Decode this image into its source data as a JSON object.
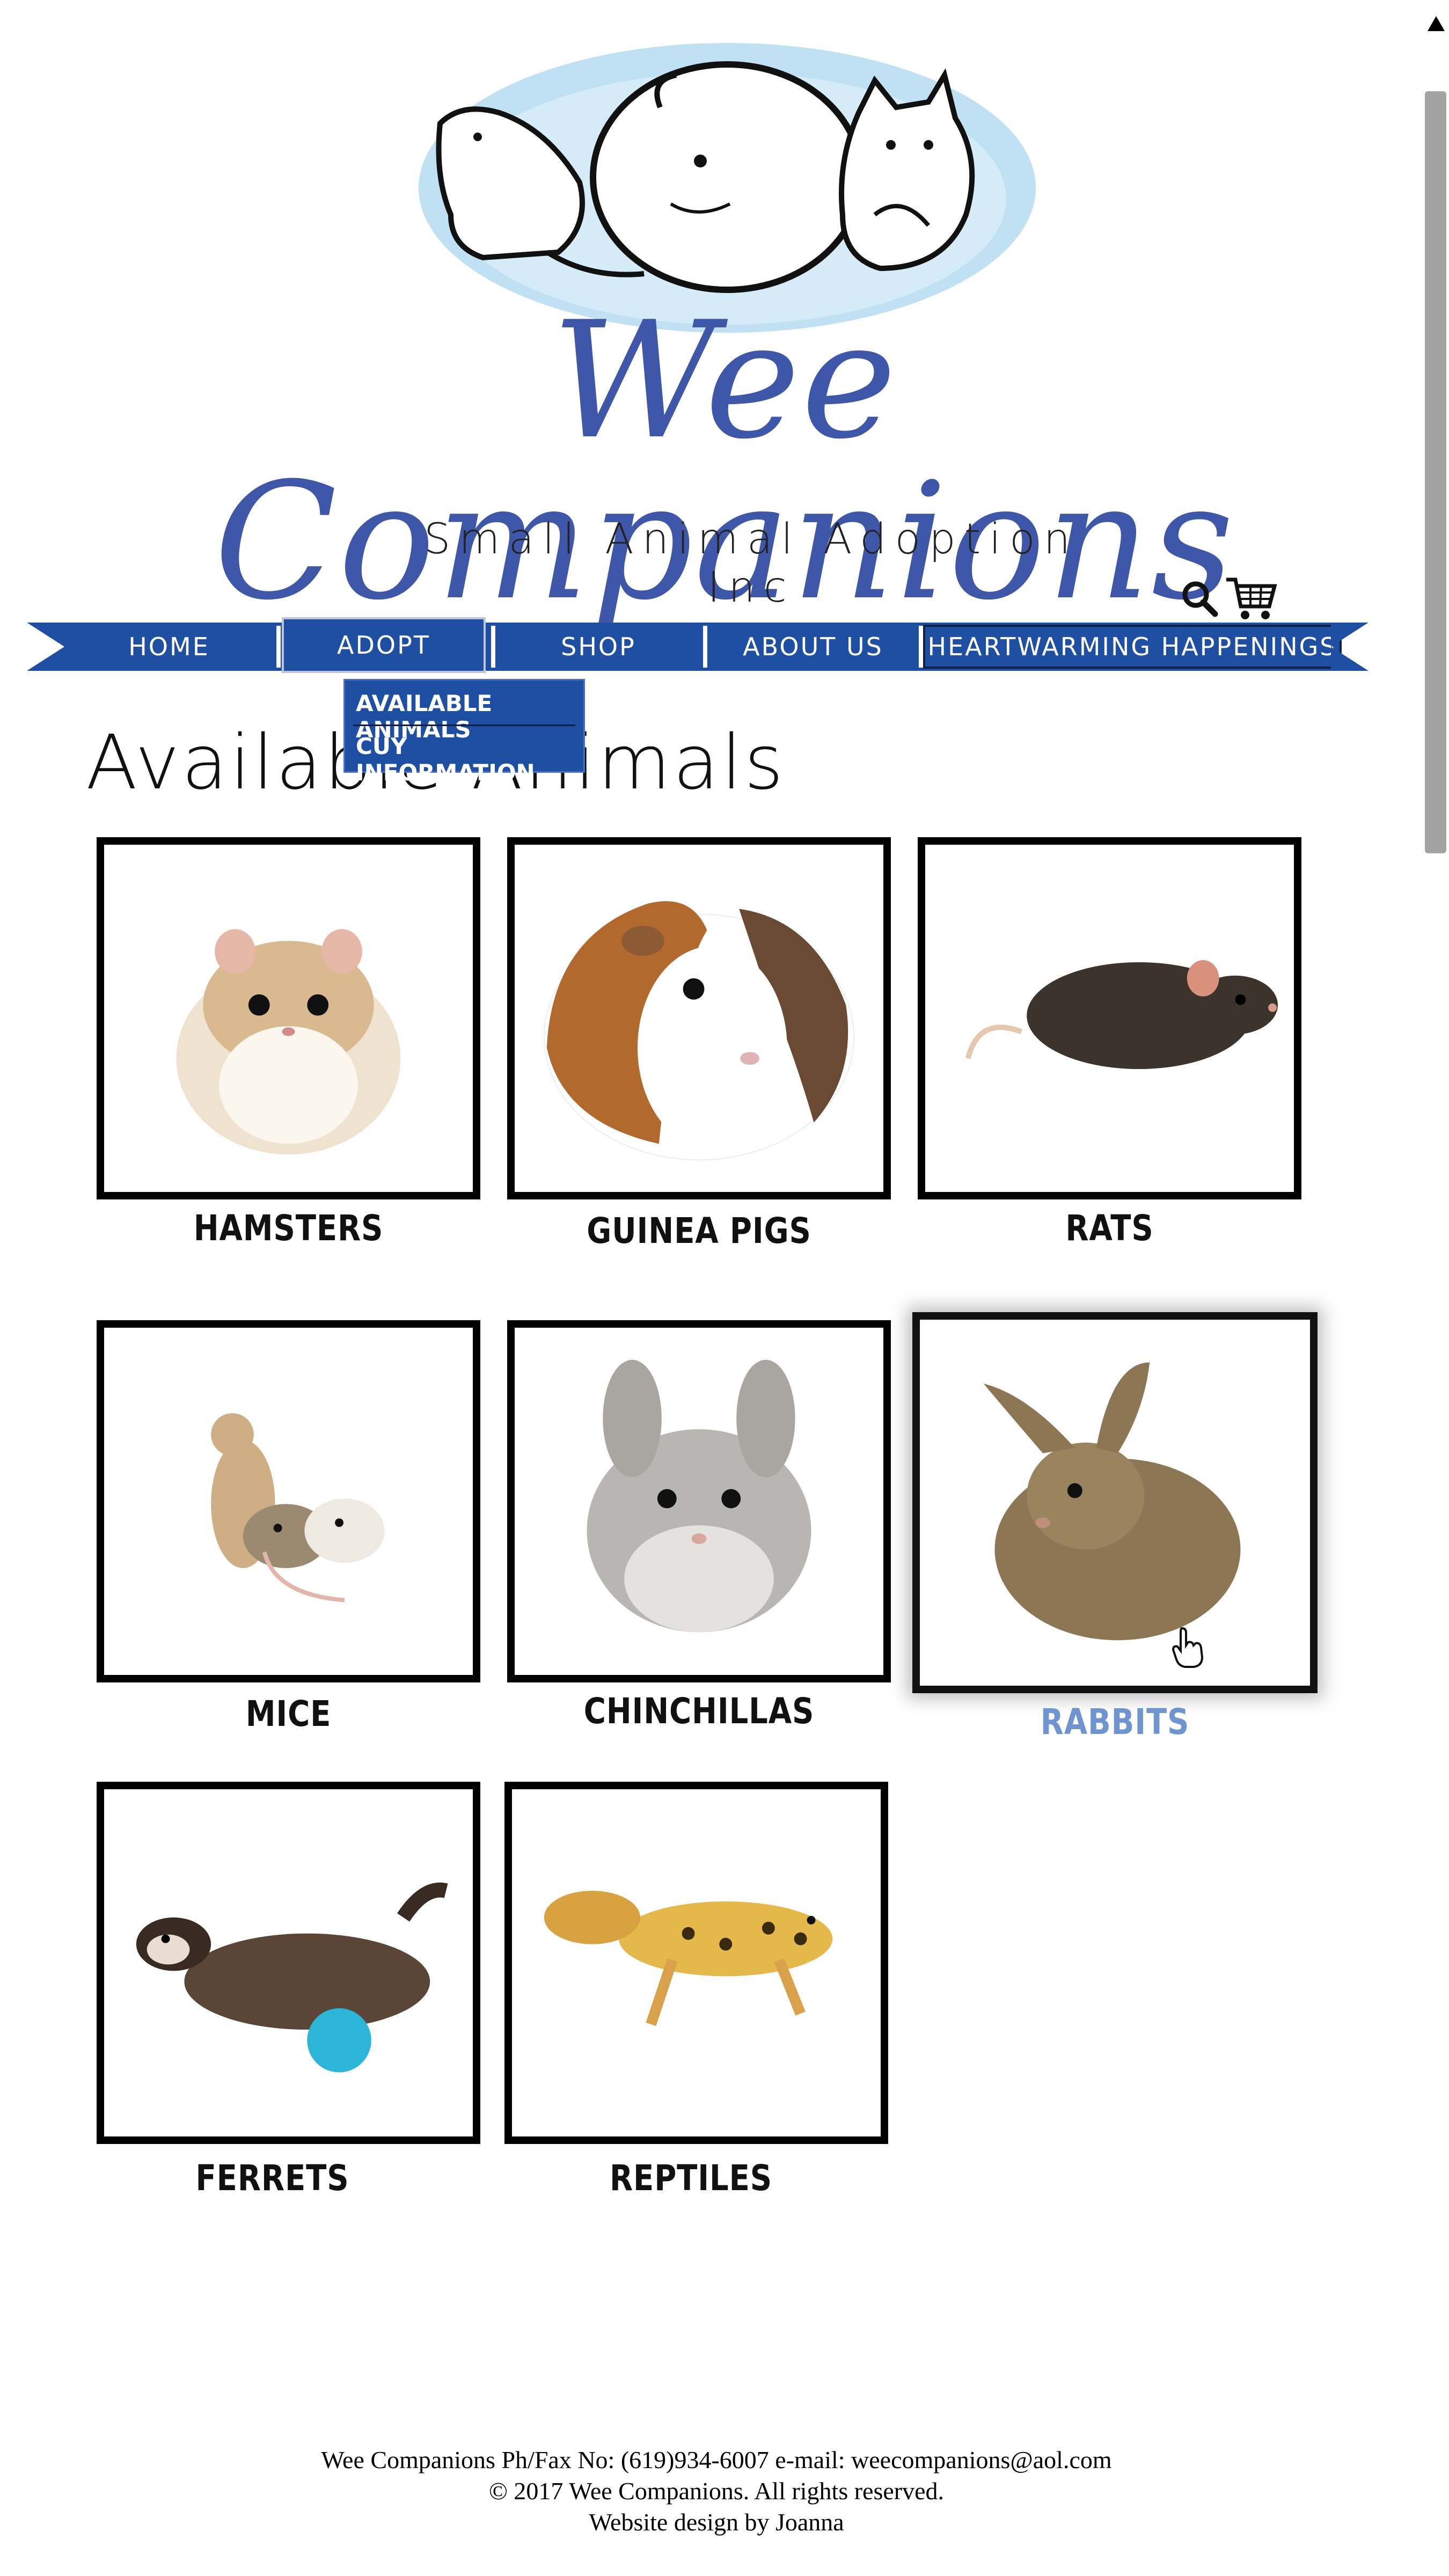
{
  "brand": {
    "name": "Wee Companions",
    "tagline": "Small Animal Adoption Inc"
  },
  "colors": {
    "brand_blue": "#3f57a8",
    "nav_blue": "#1f4fa3",
    "hover_label": "#6e95d0"
  },
  "header_icons": [
    "search-icon",
    "cart-icon"
  ],
  "nav": {
    "home": "HOME",
    "adopt": "ADOPT",
    "shop": "SHOP",
    "about": "ABOUT US",
    "happenings": "HEARTWARMING HAPPENINGS"
  },
  "dropdown": {
    "items": [
      "AVAILABLE ANIMALS",
      "CUY INFORMATION"
    ]
  },
  "page_title": "Available Animals",
  "animals": [
    {
      "label": "HAMSTERS"
    },
    {
      "label": "GUINEA PIGS"
    },
    {
      "label": "RATS"
    },
    {
      "label": "MICE"
    },
    {
      "label": "CHINCHILLAS"
    },
    {
      "label": "RABBITS",
      "state": "hover"
    },
    {
      "label": "FERRETS"
    },
    {
      "label": "REPTILES"
    }
  ],
  "footer": {
    "line1": "Wee Companions Ph/Fax No: (619)934-6007 e-mail: weecompanions@aol.com",
    "line2": "© 2017 Wee Companions. All rights reserved.",
    "line3": "Website design by Joanna"
  }
}
